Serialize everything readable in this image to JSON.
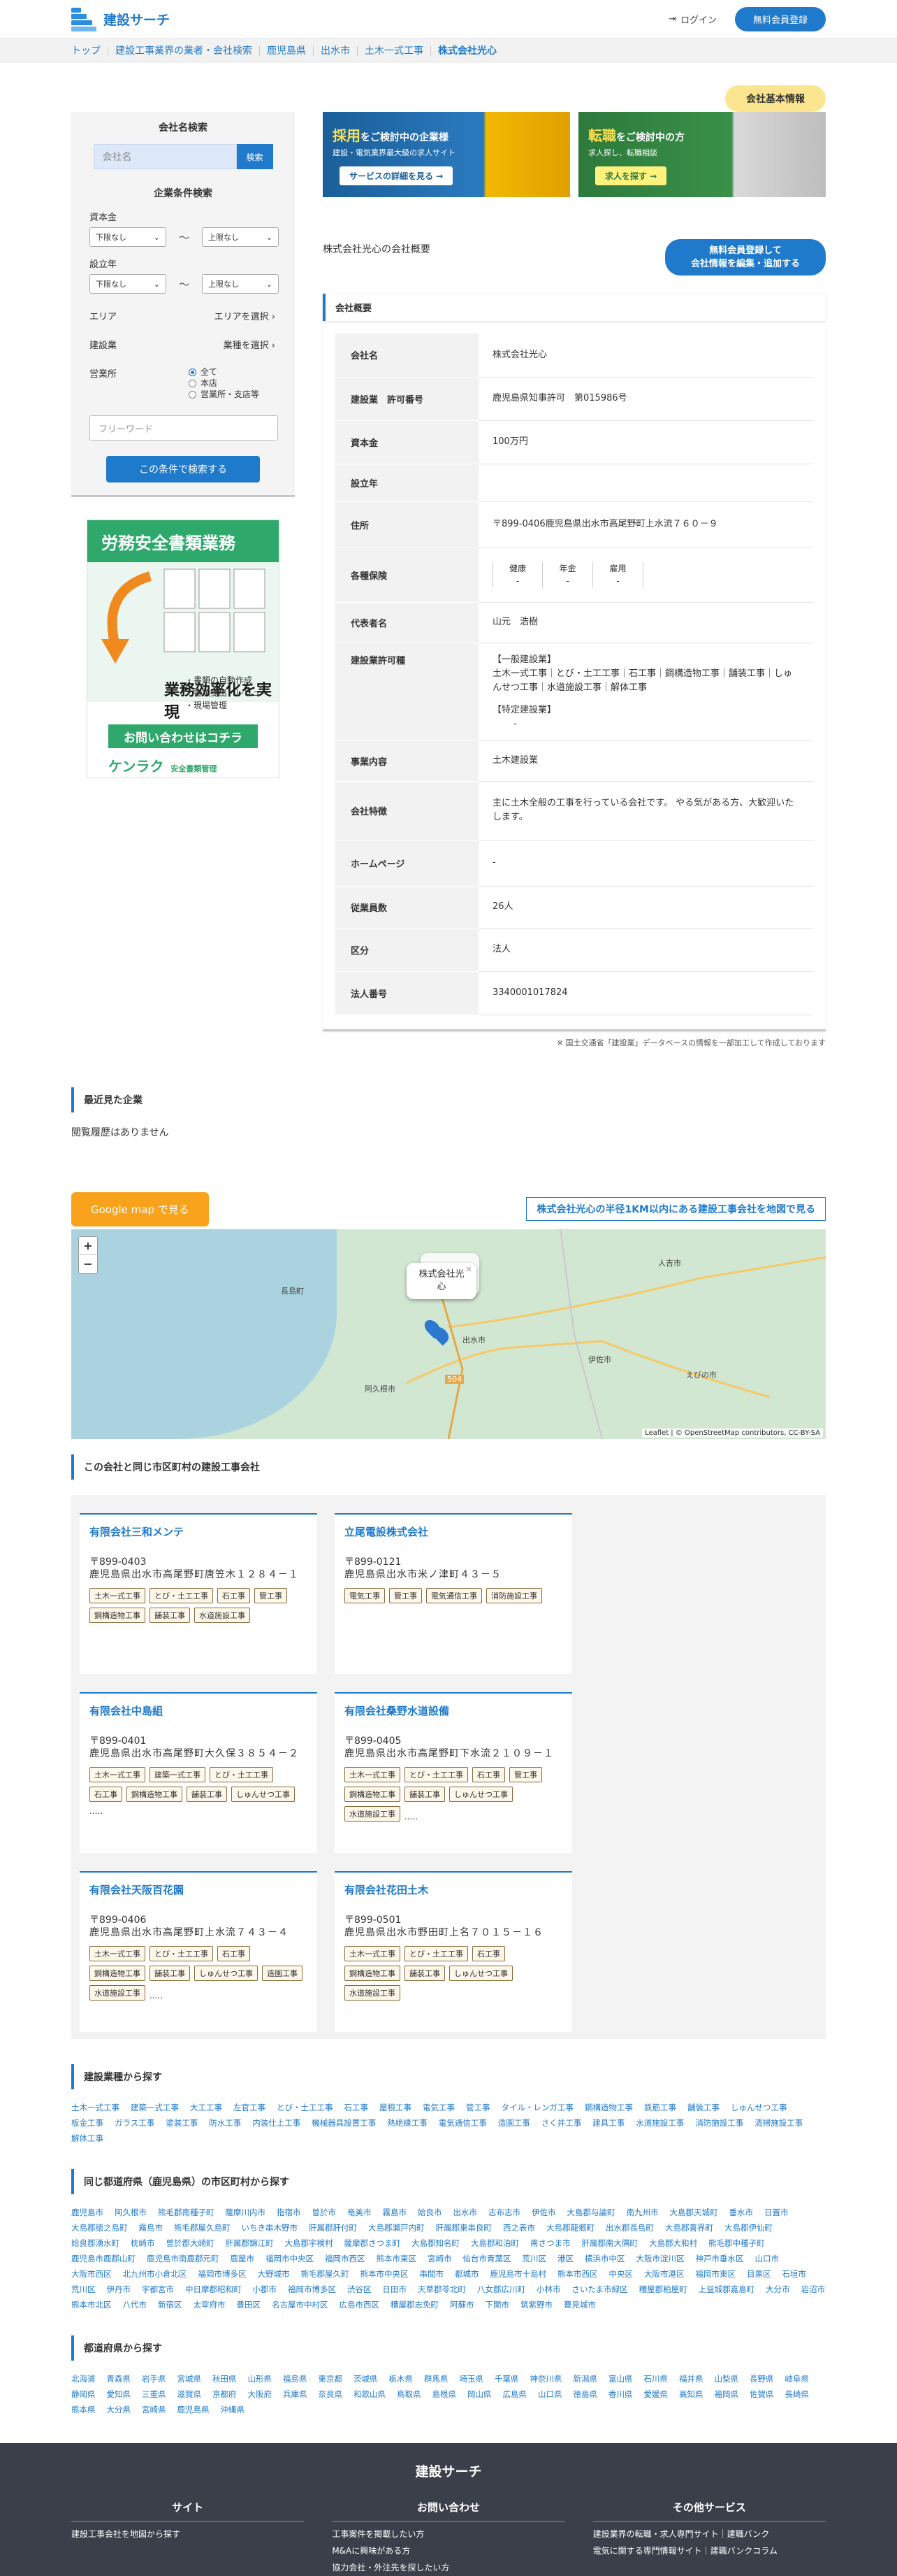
{
  "header": {
    "logo": "建設サーチ",
    "login": "ログイン",
    "register": "無料会員登録"
  },
  "breadcrumb": [
    "トップ",
    "建設工事業界の業者・会社検索",
    "鹿児島県",
    "出水市",
    "土木一式工事",
    "株式会社光心"
  ],
  "badge": "会社基本情報",
  "sidebar": {
    "name_search_title": "会社名検索",
    "name_placeholder": "会社名",
    "search_btn": "検索",
    "cond_title": "企業条件検索",
    "capital_label": "資本金",
    "established_label": "設立年",
    "min_label": "下限なし",
    "max_label": "上限なし",
    "tilde": "〜",
    "area_label": "エリア",
    "area_pick": "エリアを選択",
    "biz_label": "建設業",
    "biz_pick": "業種を選択",
    "office_label": "営業所",
    "office_opts": [
      "全て",
      "本店",
      "営業所・支店等"
    ],
    "freeword": "フリーワード",
    "cond_btn": "この条件で検索する"
  },
  "ad": {
    "title": "労務安全書類業務",
    "title2": "業務効率化を実現",
    "list": [
      "・書類の自動作成",
      "・書類提出・レビュー",
      "・現場管理"
    ],
    "cta": "お問い合わせはコチラ",
    "brand": "ケンラク",
    "brand_sub": "安全書類管理"
  },
  "banners": [
    {
      "title_em": "採用",
      "title": "をご検討中の企業様",
      "sub": "建設・電気業界最大級の求人サイト",
      "btn": "サービスの詳細を見る →"
    },
    {
      "title_em": "転職",
      "title": "をご検討中の方",
      "sub": "求人探し、転職相談",
      "btn": "求人を探す →"
    }
  ],
  "overview": {
    "heading": "株式会社光心の会社概要",
    "edit_btn_1": "無料会員登録して",
    "edit_btn_2": "会社情報を編集・追加する",
    "section": "会社概要"
  },
  "info": {
    "rows": [
      {
        "k": "会社名",
        "v": "株式会社光心"
      },
      {
        "k": "建設業　許可番号",
        "v": "鹿児島県知事許可　第015986号"
      },
      {
        "k": "資本金",
        "v": "100万円"
      },
      {
        "k": "設立年",
        "v": ""
      },
      {
        "k": "住所",
        "v": "〒899-0406鹿児島県出水市高尾野町上水流７６０－９"
      },
      {
        "k": "各種保険",
        "v": ""
      },
      {
        "k": "代表者名",
        "v": "山元　浩樹"
      },
      {
        "k": "建設業許可種",
        "v": ""
      },
      {
        "k": "事業内容",
        "v": "土木建設業"
      },
      {
        "k": "会社特徴",
        "v": "主に土木全般の工事を行っている会社です。 やる気がある方、大歓迎いたします。"
      },
      {
        "k": "ホームページ",
        "v": "-"
      },
      {
        "k": "従業員数",
        "v": "26人"
      },
      {
        "k": "区分",
        "v": "法人"
      },
      {
        "k": "法人番号",
        "v": "3340001017824"
      }
    ],
    "insurance": [
      {
        "name": "健康",
        "val": "-"
      },
      {
        "name": "年金",
        "val": "-"
      },
      {
        "name": "雇用",
        "val": "-"
      }
    ],
    "permit_general_label": "【一般建設業】",
    "permit_general": "土木一式工事｜とび・土工工事｜石工事｜鋼構造物工事｜舗装工事｜しゅんせつ工事｜水道施設工事｜解体工事",
    "permit_special_label": "【特定建設業】",
    "permit_special": "-",
    "note": "※ 国土交通省「建設業」データベースの情報を一部加工して作成しております"
  },
  "recent": {
    "title": "最近見た企業",
    "empty": "閲覧履歴はありません"
  },
  "map": {
    "gmap_btn": "Google map で見る",
    "radius_link": "株式会社光心の半径1KM以内にある建設工事会社を地図で見る",
    "popup": "株式会社光心",
    "labels": [
      "人吉市",
      "出水市",
      "伊佐市",
      "阿久根市",
      "長島町",
      "えびの市"
    ],
    "attribution": "Leaflet | © OpenStreetMap contributors, CC-BY-SA",
    "road": "504"
  },
  "same_city": {
    "title": "この会社と同じ市区町村の建設工事会社",
    "cards": [
      {
        "name": "有限会社三和メンテ",
        "zip": "〒899-0403",
        "addr": "鹿児島県出水市高尾野町唐笠木１２８４－１",
        "tags": [
          "土木一式工事",
          "とび・土工工事",
          "石工事",
          "管工事",
          "鋼構造物工事",
          "舗装工事",
          "水道施設工事"
        ],
        "more": ""
      },
      {
        "name": "立尾電設株式会社",
        "zip": "〒899-0121",
        "addr": "鹿児島県出水市米ノ津町４３－５",
        "tags": [
          "電気工事",
          "管工事",
          "電気通信工事",
          "消防施設工事"
        ],
        "more": ""
      },
      {
        "name": "有限会社中島組",
        "zip": "〒899-0401",
        "addr": "鹿児島県出水市高尾野町大久保３８５４－２",
        "tags": [
          "土木一式工事",
          "建築一式工事",
          "とび・土工工事",
          "石工事",
          "鋼構造物工事",
          "舗装工事",
          "しゅんせつ工事"
        ],
        "more": "....."
      },
      {
        "name": "有限会社桑野水道設備",
        "zip": "〒899-0405",
        "addr": "鹿児島県出水市高尾野町下水流２１０９－１",
        "tags": [
          "土木一式工事",
          "とび・土工工事",
          "石工事",
          "管工事",
          "鋼構造物工事",
          "舗装工事",
          "しゅんせつ工事",
          "水道施設工事"
        ],
        "more": "....."
      },
      {
        "name": "有限会社天阪百花園",
        "zip": "〒899-0406",
        "addr": "鹿児島県出水市高尾野町上水流７４３－４",
        "tags": [
          "土木一式工事",
          "とび・土工工事",
          "石工事",
          "鋼構造物工事",
          "舗装工事",
          "しゅんせつ工事",
          "造園工事",
          "水道施設工事"
        ],
        "more": "....."
      },
      {
        "name": "有限会社花田土木",
        "zip": "〒899-0501",
        "addr": "鹿児島県出水市野田町上名７０１５－１６",
        "tags": [
          "土木一式工事",
          "とび・土工工事",
          "石工事",
          "鋼構造物工事",
          "舗装工事",
          "しゅんせつ工事",
          "水道施設工事"
        ],
        "more": ""
      }
    ]
  },
  "by_type": {
    "title": "建設業種から探す",
    "items": [
      "土木一式工事",
      "建築一式工事",
      "大工工事",
      "左官工事",
      "とび・土工工事",
      "石工事",
      "屋根工事",
      "電気工事",
      "管工事",
      "タイル・レンガ工事",
      "鋼構造物工事",
      "鉄筋工事",
      "舗装工事",
      "しゅんせつ工事",
      "板金工事",
      "ガラス工事",
      "塗装工事",
      "防水工事",
      "内装仕上工事",
      "機械器具設置工事",
      "熱絶縁工事",
      "電気通信工事",
      "造園工事",
      "さく井工事",
      "建具工事",
      "水道施設工事",
      "消防施設工事",
      "清掃施設工事",
      "解体工事"
    ]
  },
  "by_city": {
    "title": "同じ都道府県（鹿児島県）の市区町村から探す",
    "items": [
      "鹿児島市",
      "阿久根市",
      "熊毛郡南種子町",
      "薩摩川内市",
      "指宿市",
      "曽於市",
      "奄美市",
      "霧島市",
      "姶良市",
      "出水市",
      "志布志市",
      "伊佐市",
      "大島郡与論町",
      "南九州市",
      "大島郡天城町",
      "垂水市",
      "日置市",
      "大島郡徳之島町",
      "霧島市",
      "熊毛郡屋久島町",
      "いちき串木野市",
      "肝属郡肝付町",
      "大島郡瀬戸内町",
      "肝属郡東串良町",
      "西之表市",
      "大島郡龍郷町",
      "出水郡長島町",
      "大島郡喜界町",
      "大島郡伊仙町",
      "姶良郡湧水町",
      "枕崎市",
      "曽於郡大崎町",
      "肝属郡錦江町",
      "大島郡宇検村",
      "薩摩郡さつま町",
      "大島郡知名町",
      "大島郡和泊町",
      "南さつま市",
      "肝属郡南大隅町",
      "大島郡大和村",
      "熊毛郡中種子町",
      "鹿児島市鹿郡山町",
      "鹿児島市南鹿郡元町",
      "鹿屋市",
      "福岡市中央区",
      "福岡市西区",
      "熊本市東区",
      "宮崎市",
      "仙台市青葉区",
      "荒川区",
      "港区",
      "横浜市中区",
      "大阪市淀川区",
      "神戸市垂水区",
      "山口市",
      "大阪市西区",
      "北九州市小倉北区",
      "福岡市博多区",
      "大野城市",
      "熊毛郡屋久町",
      "熊本市中央区",
      "串間市",
      "都城市",
      "鹿児島市十島村",
      "熊本市西区",
      "中央区",
      "大阪市港区",
      "福岡市東区",
      "目黒区",
      "石垣市",
      "荒川区",
      "伊丹市",
      "宇都宮市",
      "中日摩郡昭和町",
      "小郡市",
      "福岡市博多区",
      "渋谷区",
      "日田市",
      "天草郡苓北町",
      "八女郡広川町",
      "小林市",
      "さいたま市緑区",
      "糟屋郡粕屋町",
      "上益城郡嘉島町",
      "大分市",
      "岩沼市",
      "熊本市北区",
      "八代市",
      "新宿区",
      "太宰府市",
      "豊田区",
      "名古屋市中村区",
      "広島市西区",
      "糟屋郡志免町",
      "阿蘇市",
      "下関市",
      "筑紫野市",
      "豊見城市"
    ]
  },
  "by_pref": {
    "title": "都道府県から探す",
    "items": [
      "北海道",
      "青森県",
      "岩手県",
      "宮城県",
      "秋田県",
      "山形県",
      "福島県",
      "東京都",
      "茨城県",
      "栃木県",
      "群馬県",
      "埼玉県",
      "千葉県",
      "神奈川県",
      "新潟県",
      "富山県",
      "石川県",
      "福井県",
      "山梨県",
      "長野県",
      "岐阜県",
      "静岡県",
      "愛知県",
      "三重県",
      "滋賀県",
      "京都府",
      "大阪府",
      "兵庫県",
      "奈良県",
      "和歌山県",
      "鳥取県",
      "島根県",
      "岡山県",
      "広島県",
      "山口県",
      "徳島県",
      "香川県",
      "愛媛県",
      "高知県",
      "福岡県",
      "佐賀県",
      "長崎県",
      "熊本県",
      "大分県",
      "宮崎県",
      "鹿児島県",
      "沖縄県"
    ]
  },
  "footer": {
    "logo": "建設サーチ",
    "cols": [
      {
        "title": "サイト",
        "links": [
          "建設工事会社を地図から探す"
        ]
      },
      {
        "title": "お問い合わせ",
        "links": [
          "工事案件を掲載したい方",
          "M&Aに興味がある方",
          "協力会社・外注先を探したい方"
        ]
      },
      {
        "title": "その他サービス",
        "links": [
          "建設業界の転職・求人専門サイト｜建職バンク",
          "電気に関する専門情報サイト｜建職バンクコラム"
        ]
      }
    ]
  },
  "colors": {
    "accent": "#1f7acb",
    "badge": "#fbe58e",
    "map_btn": "#f8a31b",
    "footer": "#3a3f49"
  }
}
